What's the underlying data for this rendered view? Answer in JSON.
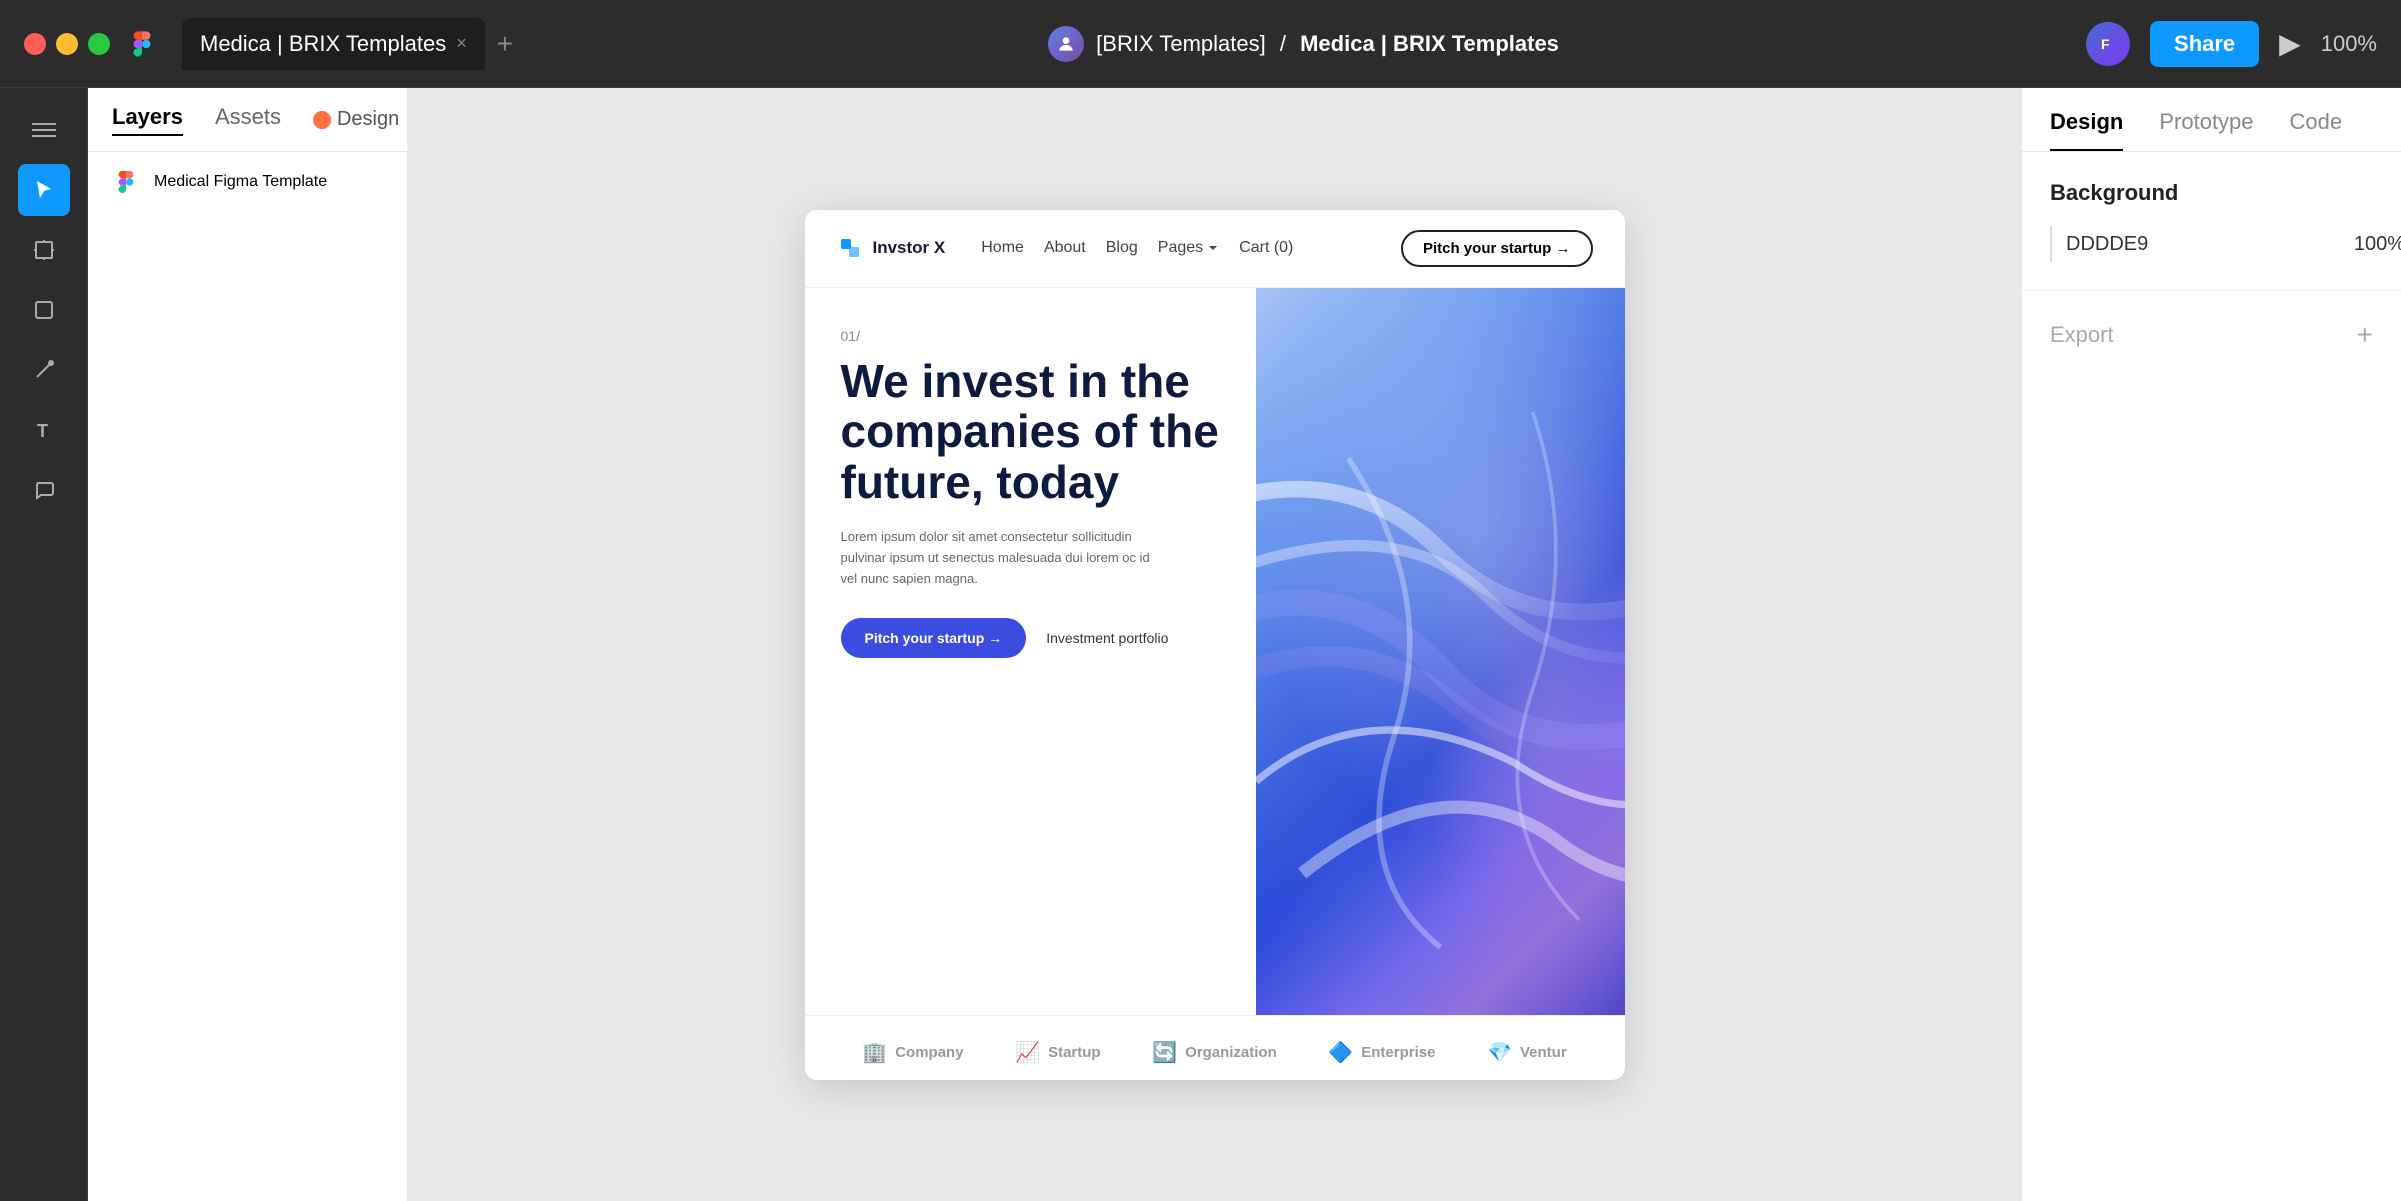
{
  "titlebar": {
    "tab_title": "Medica | BRIX Templates",
    "tab_close": "×",
    "tab_add": "+",
    "breadcrumb_org": "[BRIX Templates]",
    "breadcrumb_sep": "/",
    "breadcrumb_file": "Medica | BRIX Templates",
    "share_label": "Share",
    "zoom_label": "100%"
  },
  "left_panel": {
    "tab_layers": "Layers",
    "tab_assets": "Assets",
    "design_label": "Design",
    "layer_name": "Medical Figma Template"
  },
  "right_panel": {
    "tab_design": "Design",
    "tab_prototype": "Prototype",
    "tab_code": "Code",
    "background_label": "Background",
    "bg_hex": "DDDDE9",
    "bg_opacity": "100%",
    "export_label": "Export"
  },
  "design_frame": {
    "nav": {
      "logo_text": "Invstor X",
      "links": [
        "Home",
        "About",
        "Blog"
      ],
      "pages_label": "Pages",
      "cart_label": "Cart (0)",
      "pitch_btn": "Pitch your startup →"
    },
    "hero": {
      "eyebrow": "01/",
      "title": "We invest in the companies of the future, today",
      "description": "Lorem ipsum dolor sit amet consectetur sollicitudin pulvinar ipsum ut senectus malesuada dui lorem oc id vel nunc sapien magna.",
      "pitch_btn": "Pitch your startup →",
      "invest_link": "Investment portfolio"
    },
    "logos": [
      {
        "icon": "🏢",
        "name": "Company"
      },
      {
        "icon": "📈",
        "name": "Startup"
      },
      {
        "icon": "🔄",
        "name": "Organization"
      },
      {
        "icon": "🔷",
        "name": "Enterprise"
      },
      {
        "icon": "💎",
        "name": "Ventur"
      }
    ]
  },
  "toolbar": {
    "menu_icon": "☰",
    "select_icon": "↖",
    "frame_icon": "#",
    "rect_icon": "□",
    "pen_icon": "✒",
    "text_icon": "T",
    "comment_icon": "💬"
  }
}
